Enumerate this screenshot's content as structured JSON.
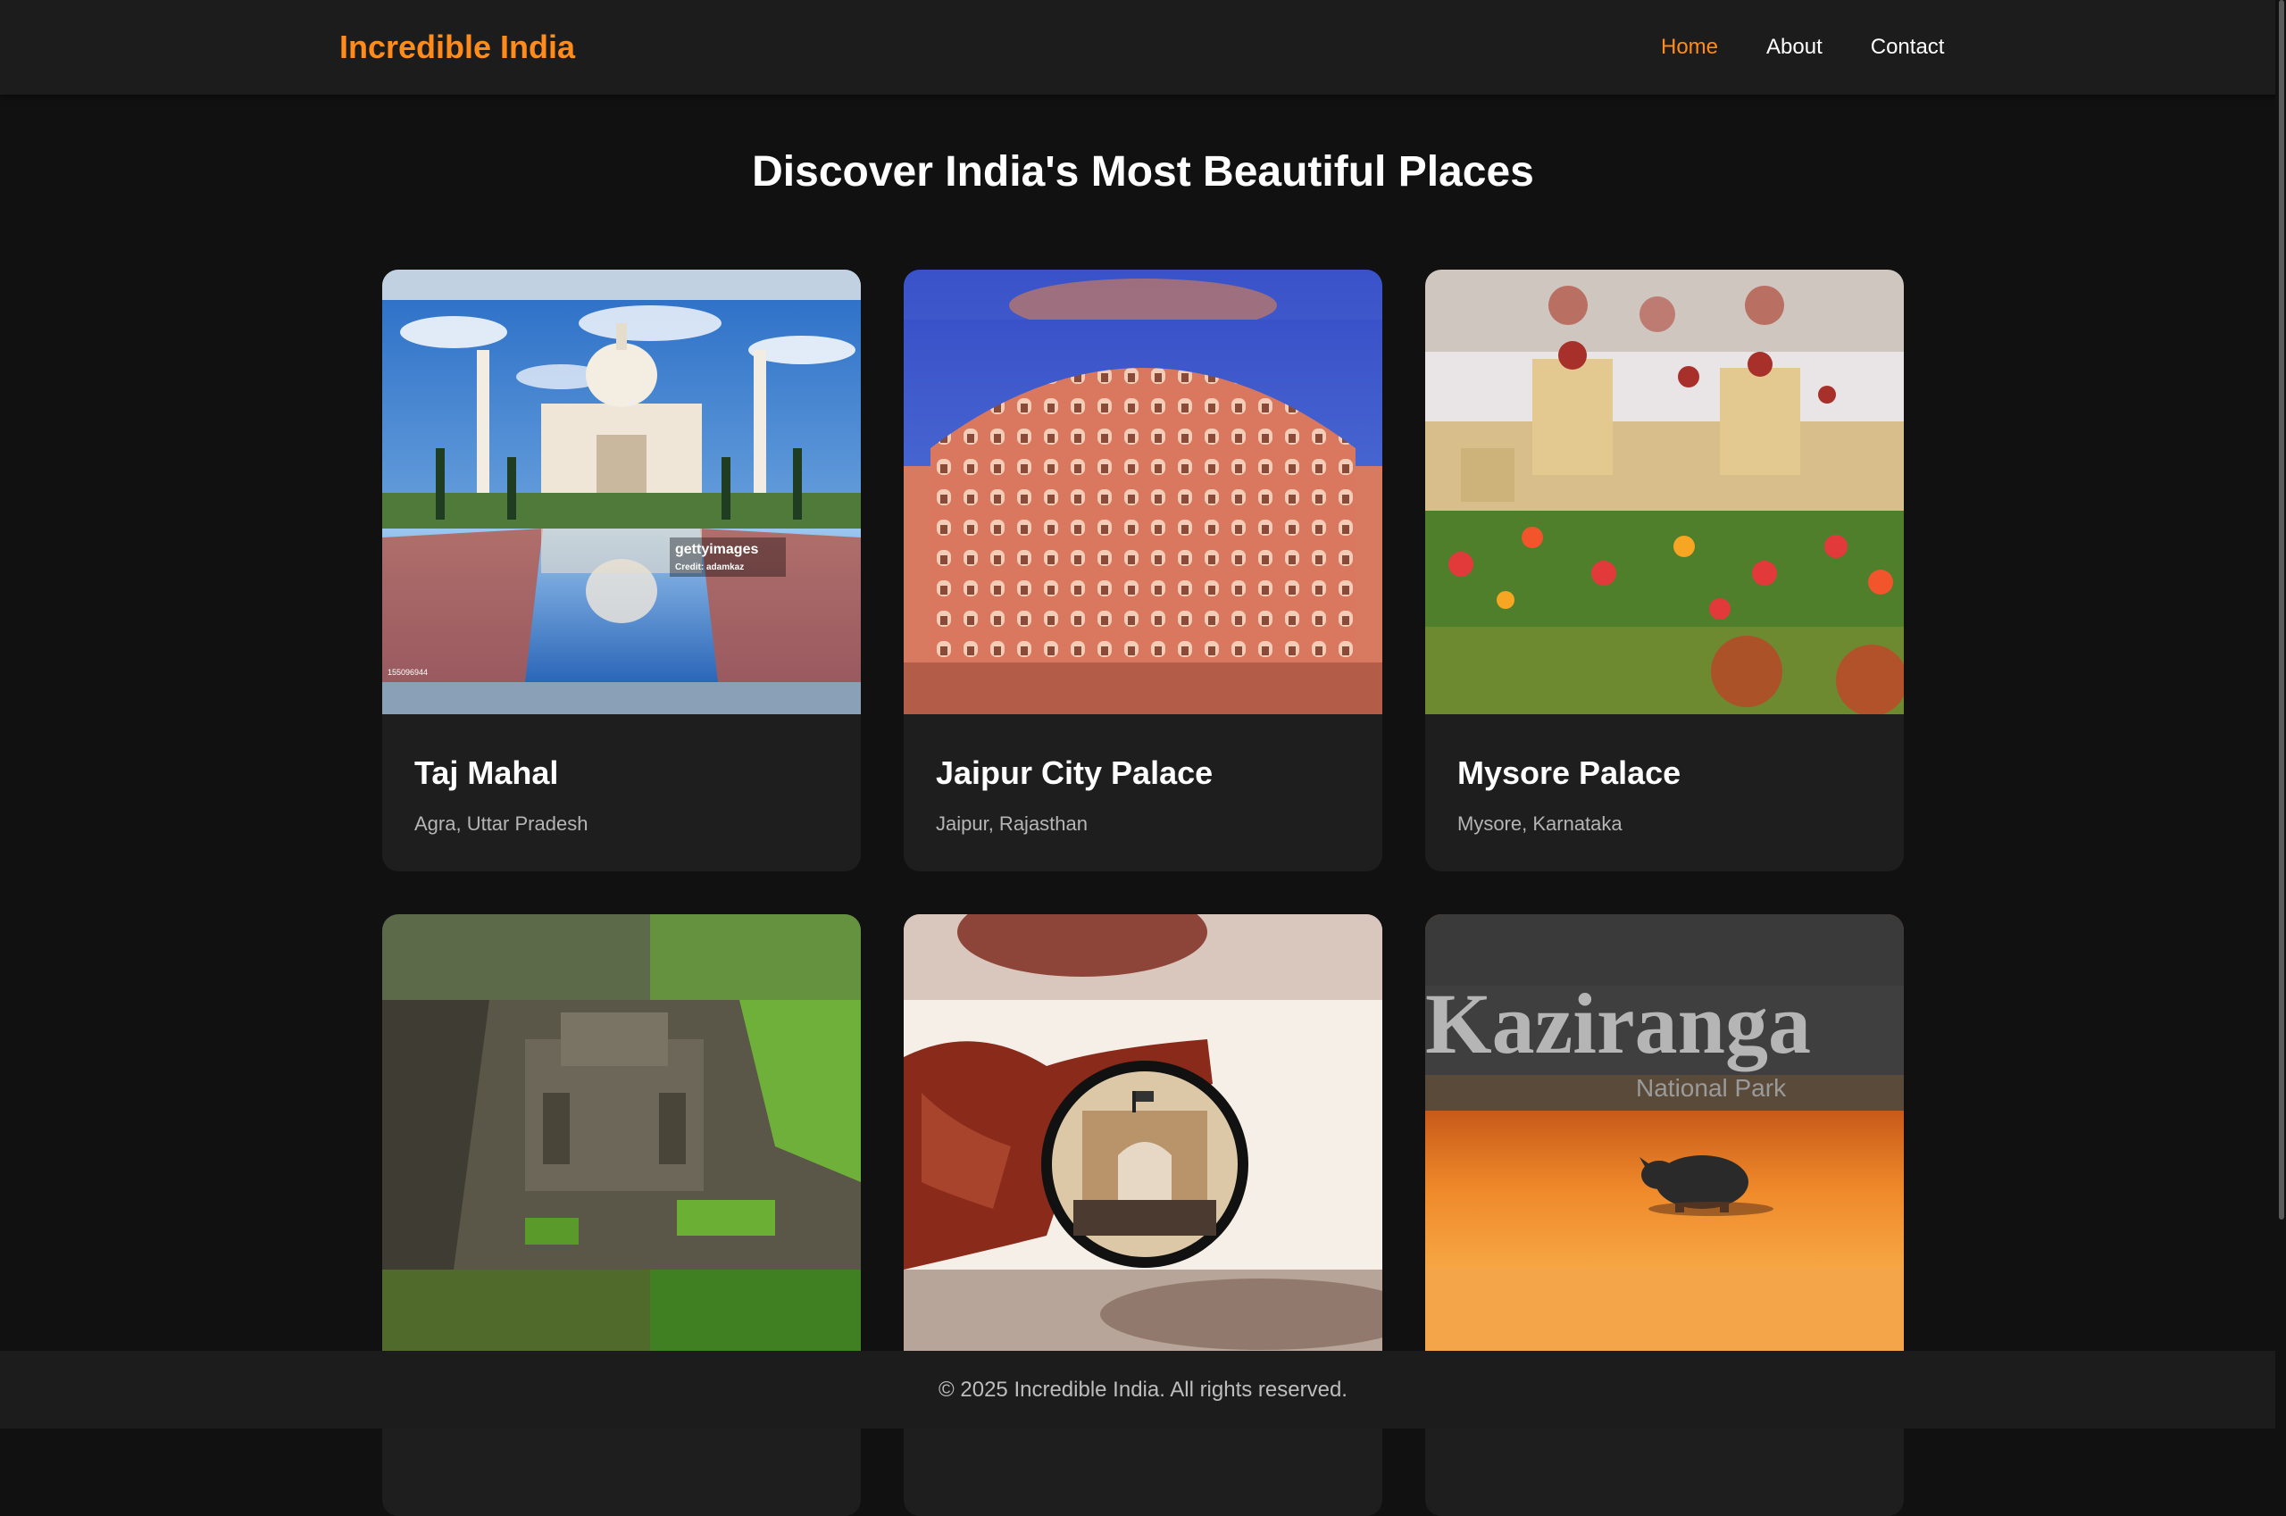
{
  "header": {
    "brand": "Incredible India",
    "nav": [
      {
        "label": "Home",
        "active": true
      },
      {
        "label": "About",
        "active": false
      },
      {
        "label": "Contact",
        "active": false
      }
    ]
  },
  "main": {
    "title": "Discover India's Most Beautiful Places",
    "cards": [
      {
        "title": "Taj Mahal",
        "location": "Agra, Uttar Pradesh",
        "image": "taj-mahal-photo",
        "watermark": "gettyimages",
        "credit": "Credit: adamkaz",
        "image_id": "155096944"
      },
      {
        "title": "Jaipur City Palace",
        "location": "Jaipur, Rajasthan",
        "image": "hawa-mahal-photo"
      },
      {
        "title": "Mysore Palace",
        "location": "Mysore, Karnataka",
        "image": "mysore-palace-photo"
      },
      {
        "title": "",
        "location": "",
        "image": "ellora-caves-photo"
      },
      {
        "title": "",
        "location": "",
        "image": "gateway-of-india-photo"
      },
      {
        "title": "",
        "location": "",
        "image": "kaziranga-photo",
        "overlay_title": "Kaziranga",
        "overlay_subtitle": "National Park"
      }
    ]
  },
  "footer": {
    "text": "© 2025 Incredible India. All rights reserved."
  },
  "colors": {
    "accent": "#ff8c1a",
    "background": "#111111",
    "card": "#1e1e1e",
    "navbar": "#1c1c1c"
  }
}
